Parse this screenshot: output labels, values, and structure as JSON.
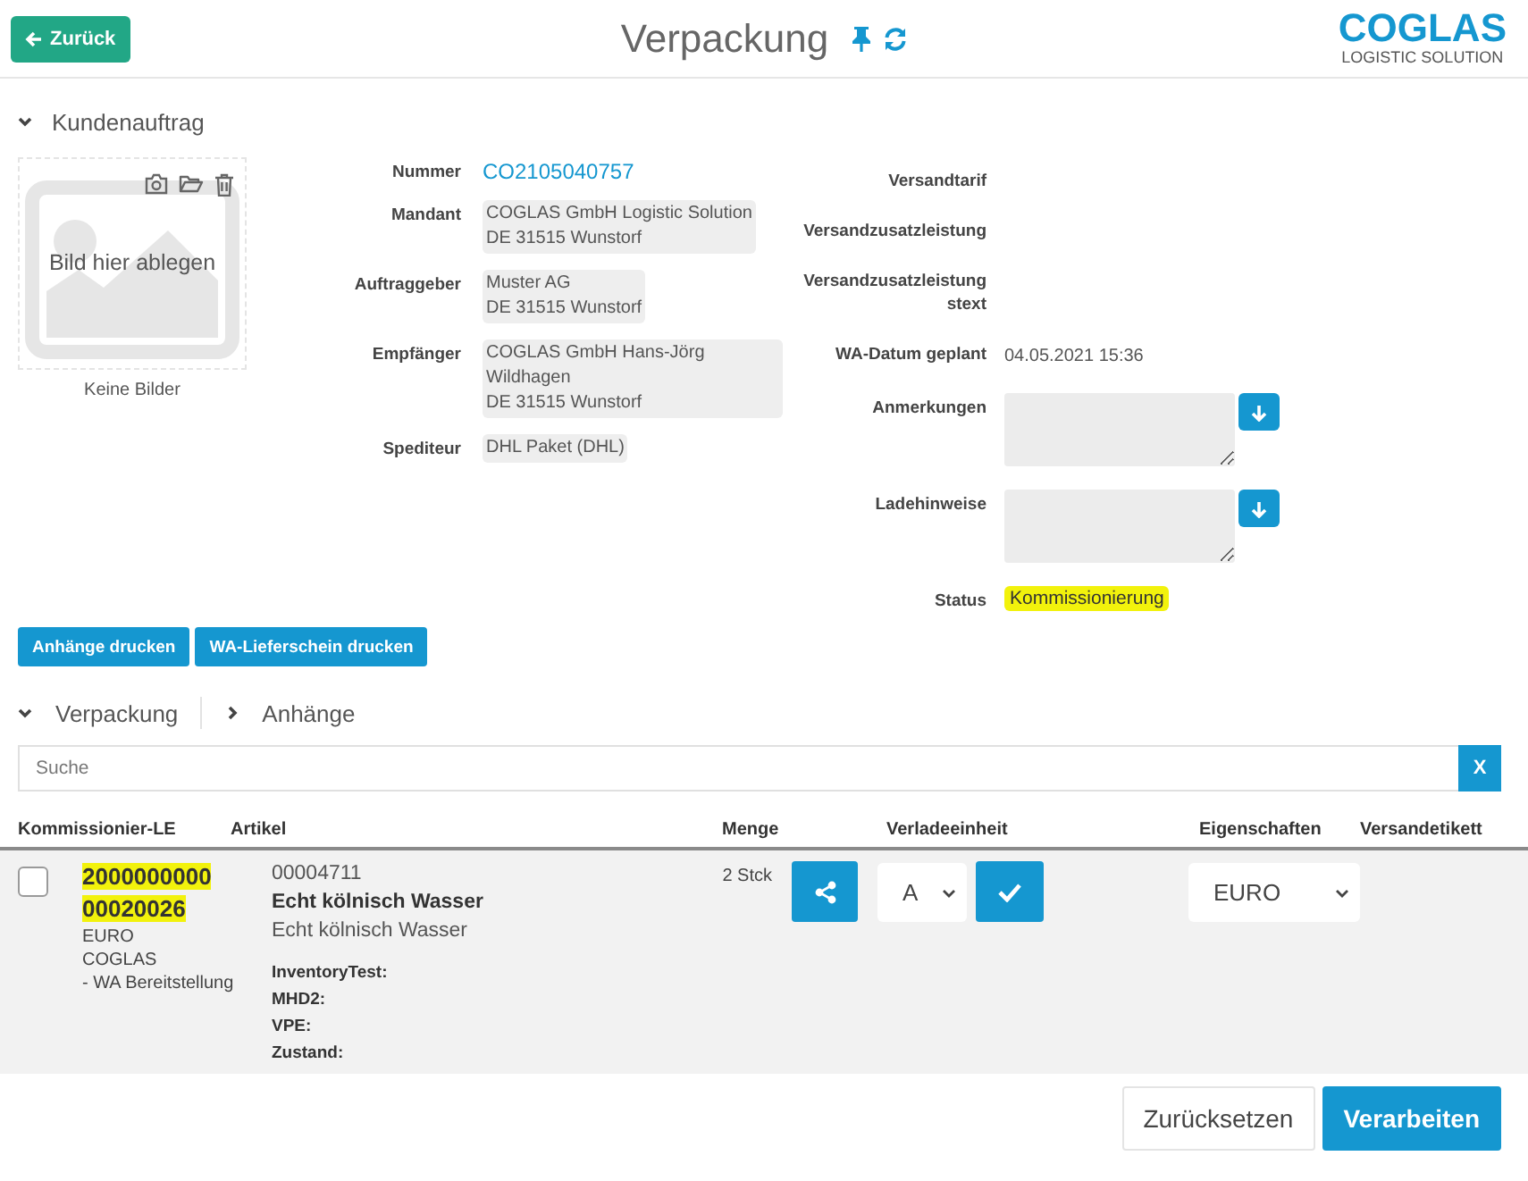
{
  "header": {
    "back_button": "Zurück",
    "title": "Verpackung",
    "logo": {
      "name": "COGLAS",
      "tagline": "LOGISTIC SOLUTION"
    }
  },
  "order_section": {
    "title": "Kundenauftrag",
    "expanded": true,
    "image_drop": {
      "hint": "Bild hier ablegen",
      "caption": "Keine Bilder"
    },
    "fields_left": [
      {
        "label": "Nummer",
        "kind": "link",
        "lines": [
          "CO2105040757"
        ]
      },
      {
        "label": "Mandant",
        "kind": "box",
        "lines": [
          "COGLAS GmbH Logistic Solution",
          "DE 31515 Wunstorf"
        ]
      },
      {
        "label": "Auftraggeber",
        "kind": "box",
        "lines": [
          "Muster AG",
          "DE 31515 Wunstorf"
        ]
      },
      {
        "label": "Empfänger",
        "kind": "box",
        "lines": [
          "COGLAS GmbH Hans-Jörg Wildhagen",
          "DE 31515 Wunstorf"
        ]
      },
      {
        "label": "Spediteur",
        "kind": "box",
        "lines": [
          "DHL Paket (DHL)"
        ]
      }
    ],
    "fields_right": [
      {
        "label": "Versandtarif",
        "kind": "empty"
      },
      {
        "label": "Versandzusatzleistung",
        "kind": "empty"
      },
      {
        "label": "Versandzusatzleistung stext",
        "kind": "empty"
      },
      {
        "label": "WA-Datum geplant",
        "kind": "text",
        "lines": [
          "04.05.2021 15:36"
        ]
      },
      {
        "label": "Anmerkungen",
        "kind": "note"
      },
      {
        "label": "Ladehinweise",
        "kind": "note"
      },
      {
        "label": "Status",
        "kind": "badge",
        "lines": [
          "Kommissionierung"
        ]
      }
    ]
  },
  "print_buttons": [
    "Anhänge drucken",
    "WA-Lieferschein drucken"
  ],
  "tabs": [
    {
      "label": "Verpackung",
      "expanded": true
    },
    {
      "label": "Anhänge",
      "expanded": false
    }
  ],
  "search": {
    "placeholder": "Suche",
    "clear_button": "X"
  },
  "table": {
    "columns": [
      "Kommissionier-LE",
      "Artikel",
      "Menge",
      "Verladeeinheit",
      "Eigenschaften",
      "Versandetikett"
    ],
    "rows": [
      {
        "checked": false,
        "le_number": "200000000000020026",
        "le_lines": [
          "EURO",
          "COGLAS",
          "- WA Bereitstellung"
        ],
        "article_number": "00004711",
        "article_name": "Echt kölnisch Wasser",
        "article_description": "Echt kölnisch Wasser",
        "attributes": [
          "InventoryTest:",
          "MHD2:",
          "VPE:",
          "Zustand:"
        ],
        "quantity": "2 Stck",
        "loading_unit": "A",
        "properties": "EURO"
      }
    ]
  },
  "footer_buttons": [
    {
      "label": "Zurücksetzen",
      "kind": "secondary"
    },
    {
      "label": "Verarbeiten",
      "kind": "primary"
    }
  ]
}
